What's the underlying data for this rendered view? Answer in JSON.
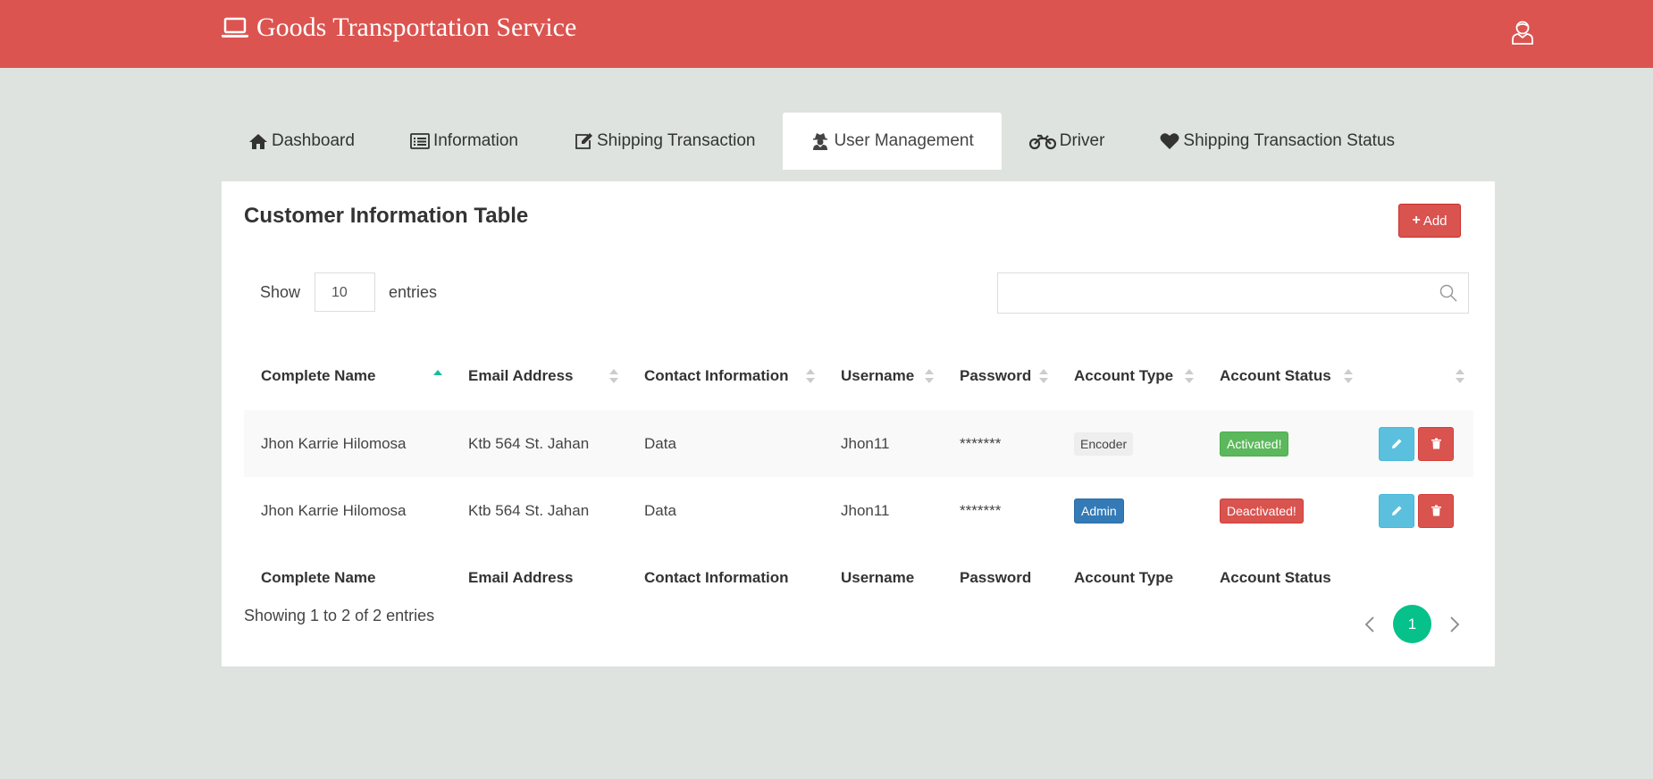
{
  "header": {
    "title": "Goods Transportation Service",
    "brand_icon": "laptop-icon",
    "user_icon": "user-avatar-icon",
    "color": "#db5450"
  },
  "tabs": [
    {
      "label": "Dashboard",
      "icon": "home-icon",
      "active": false
    },
    {
      "label": "Information",
      "icon": "list-icon",
      "active": false
    },
    {
      "label": "Shipping Transaction",
      "icon": "edit-icon",
      "active": false
    },
    {
      "label": "User Management",
      "icon": "user-secret-icon",
      "active": true
    },
    {
      "label": "Driver",
      "icon": "motorcycle-icon",
      "active": false
    },
    {
      "label": "Shipping Transaction Status",
      "icon": "heart-icon",
      "active": false
    }
  ],
  "panel": {
    "title": "Customer Information Table",
    "add_label": "Add",
    "show_label": "Show",
    "entries_label": "entries",
    "page_length": "10",
    "search_value": "",
    "info": "Showing 1 to 2 of 2 entries"
  },
  "table": {
    "columns": [
      "Complete Name",
      "Email Address",
      "Contact Information",
      "Username",
      "Password",
      "Account Type",
      "Account Status"
    ],
    "sorted_column": "Complete Name",
    "sort_direction": "ascending",
    "rows": [
      {
        "name": "Jhon Karrie Hilomosa",
        "email": "Ktb 564 St. Jahan",
        "contact": "Data",
        "username": "Jhon11",
        "password": "*******",
        "type": "Encoder",
        "type_style": "default",
        "status": "Activated!",
        "status_style": "success"
      },
      {
        "name": "Jhon Karrie Hilomosa",
        "email": "Ktb 564 St. Jahan",
        "contact": "Data",
        "username": "Jhon11",
        "password": "*******",
        "type": "Admin",
        "type_style": "primary",
        "status": "Deactivated!",
        "status_style": "danger"
      }
    ]
  },
  "pagination": {
    "current_page": "1",
    "prev_icon": "chevron-left-icon",
    "next_icon": "chevron-right-icon",
    "active_color": "#06c189"
  }
}
